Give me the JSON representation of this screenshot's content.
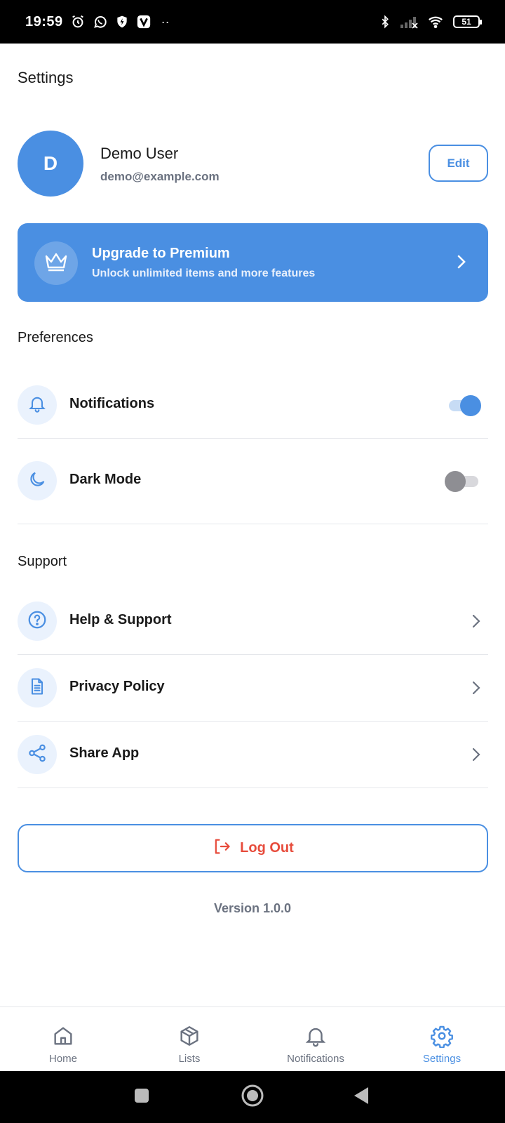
{
  "status_bar": {
    "time": "19:59",
    "dots": "··",
    "battery": "51"
  },
  "page": {
    "title": "Settings"
  },
  "profile": {
    "avatar_initial": "D",
    "name": "Demo User",
    "email": "demo@example.com",
    "edit_label": "Edit"
  },
  "premium": {
    "title": "Upgrade to Premium",
    "subtitle": "Unlock unlimited items and more features"
  },
  "preferences": {
    "section_label": "Preferences",
    "items": [
      {
        "label": "Notifications",
        "icon": "bell-icon",
        "toggle_on": true
      },
      {
        "label": "Dark Mode",
        "icon": "moon-icon",
        "toggle_on": false
      }
    ]
  },
  "support": {
    "section_label": "Support",
    "items": [
      {
        "label": "Help & Support",
        "icon": "help-circle-icon"
      },
      {
        "label": "Privacy Policy",
        "icon": "document-icon"
      },
      {
        "label": "Share App",
        "icon": "share-icon"
      }
    ]
  },
  "logout": {
    "label": "Log Out"
  },
  "version": "Version 1.0.0",
  "bottom_nav": {
    "items": [
      {
        "label": "Home",
        "icon": "home-icon",
        "active": false
      },
      {
        "label": "Lists",
        "icon": "box-icon",
        "active": false
      },
      {
        "label": "Notifications",
        "icon": "bell-icon",
        "active": false
      },
      {
        "label": "Settings",
        "icon": "gear-icon",
        "active": true
      }
    ]
  },
  "colors": {
    "accent": "#4a8fe2",
    "danger": "#e74c3c",
    "muted_text": "#6b7280",
    "icon_bg": "#eaf2fd"
  }
}
